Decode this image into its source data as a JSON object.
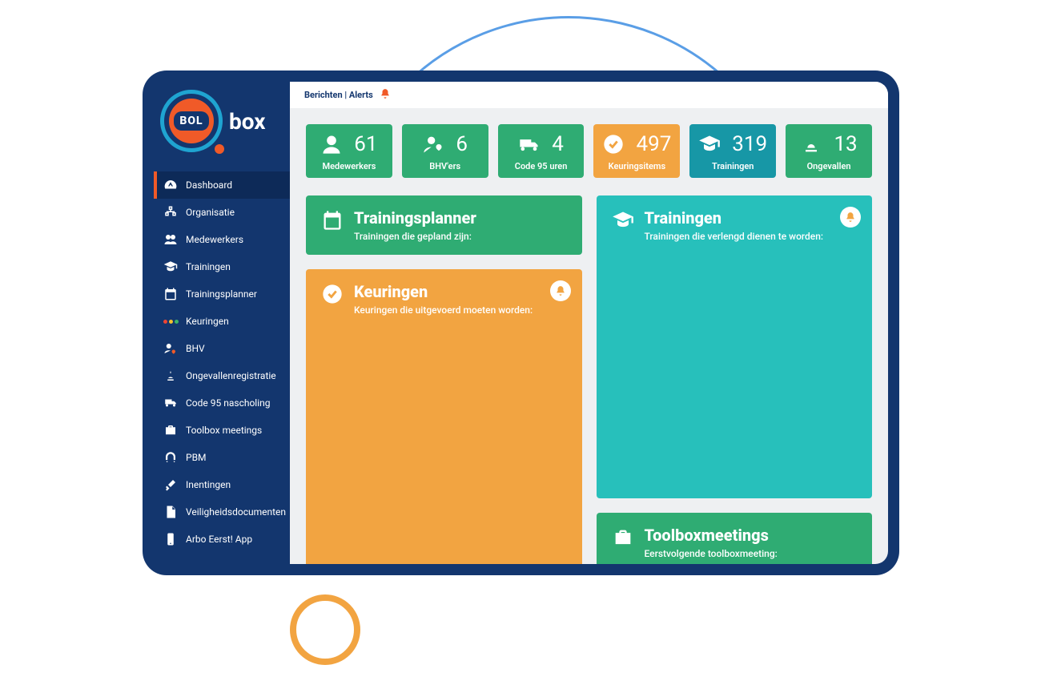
{
  "logo": {
    "bol": "BOL",
    "box": "box"
  },
  "topbar": {
    "alerts": "Berichten | Alerts"
  },
  "sidebar": {
    "items": [
      {
        "label": "Dashboard"
      },
      {
        "label": "Organisatie"
      },
      {
        "label": "Medewerkers"
      },
      {
        "label": "Trainingen"
      },
      {
        "label": "Trainingsplanner"
      },
      {
        "label": "Keuringen"
      },
      {
        "label": "BHV"
      },
      {
        "label": "Ongevallenregistratie"
      },
      {
        "label": "Code 95 nascholing"
      },
      {
        "label": "Toolbox meetings"
      },
      {
        "label": "PBM"
      },
      {
        "label": "Inentingen"
      },
      {
        "label": "Veiligheidsdocumenten"
      },
      {
        "label": "Arbo Eerst! App"
      }
    ]
  },
  "stats": [
    {
      "value": "61",
      "label": "Medewerkers"
    },
    {
      "value": "6",
      "label": "BHV'ers"
    },
    {
      "value": "4",
      "label": "Code 95 uren"
    },
    {
      "value": "497",
      "label": "Keuringsitems"
    },
    {
      "value": "319",
      "label": "Trainingen"
    },
    {
      "value": "13",
      "label": "Ongevallen"
    }
  ],
  "cards": {
    "planner": {
      "title": "Trainingsplanner",
      "sub": "Trainingen die gepland zijn:"
    },
    "keuringen": {
      "title": "Keuringen",
      "sub": "Keuringen die uitgevoerd moeten worden:"
    },
    "trainingen": {
      "title": "Trainingen",
      "sub": "Trainingen die verlengd dienen te worden:"
    },
    "toolbox": {
      "title": "Toolboxmeetings",
      "sub": "Eerstvolgende toolboxmeeting:"
    }
  },
  "colors": {
    "navy": "#13366e",
    "orange": "#f2a441",
    "orangeAccent": "#f05a28",
    "green": "#2fac73",
    "teal": "#27c0bb",
    "tealblue": "#1797a6"
  }
}
